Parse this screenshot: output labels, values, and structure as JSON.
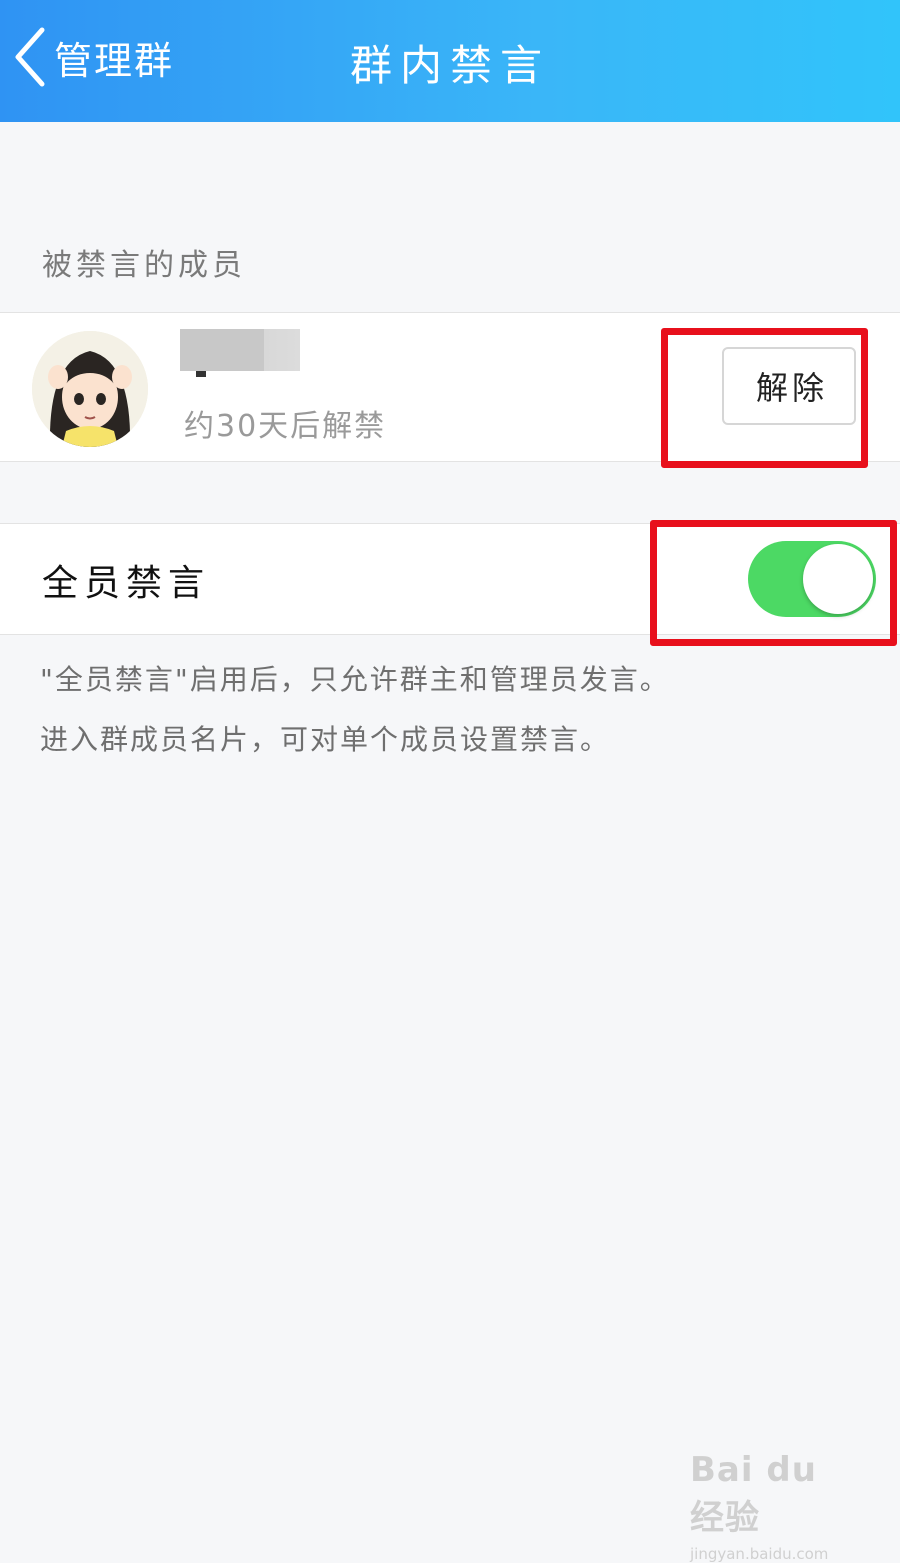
{
  "nav": {
    "back_label": "管理群",
    "title": "群内禁言"
  },
  "muted_section": {
    "label": "被禁言的成员"
  },
  "member": {
    "remaining": "约30天后解禁",
    "unmute_label": "解除"
  },
  "mute_all": {
    "label": "全员禁言",
    "enabled": true
  },
  "hints": {
    "line1": "\"全员禁言\"启用后，只允许群主和管理员发言。",
    "line2": "进入群成员名片，可对单个成员设置禁言。"
  },
  "watermark": {
    "logo": "Bai du 经验",
    "url": "jingyan.baidu.com"
  },
  "colors": {
    "nav_start": "#2f93f3",
    "nav_end": "#31c4fa",
    "toggle_on": "#4cd964",
    "highlight": "#e8101c"
  }
}
